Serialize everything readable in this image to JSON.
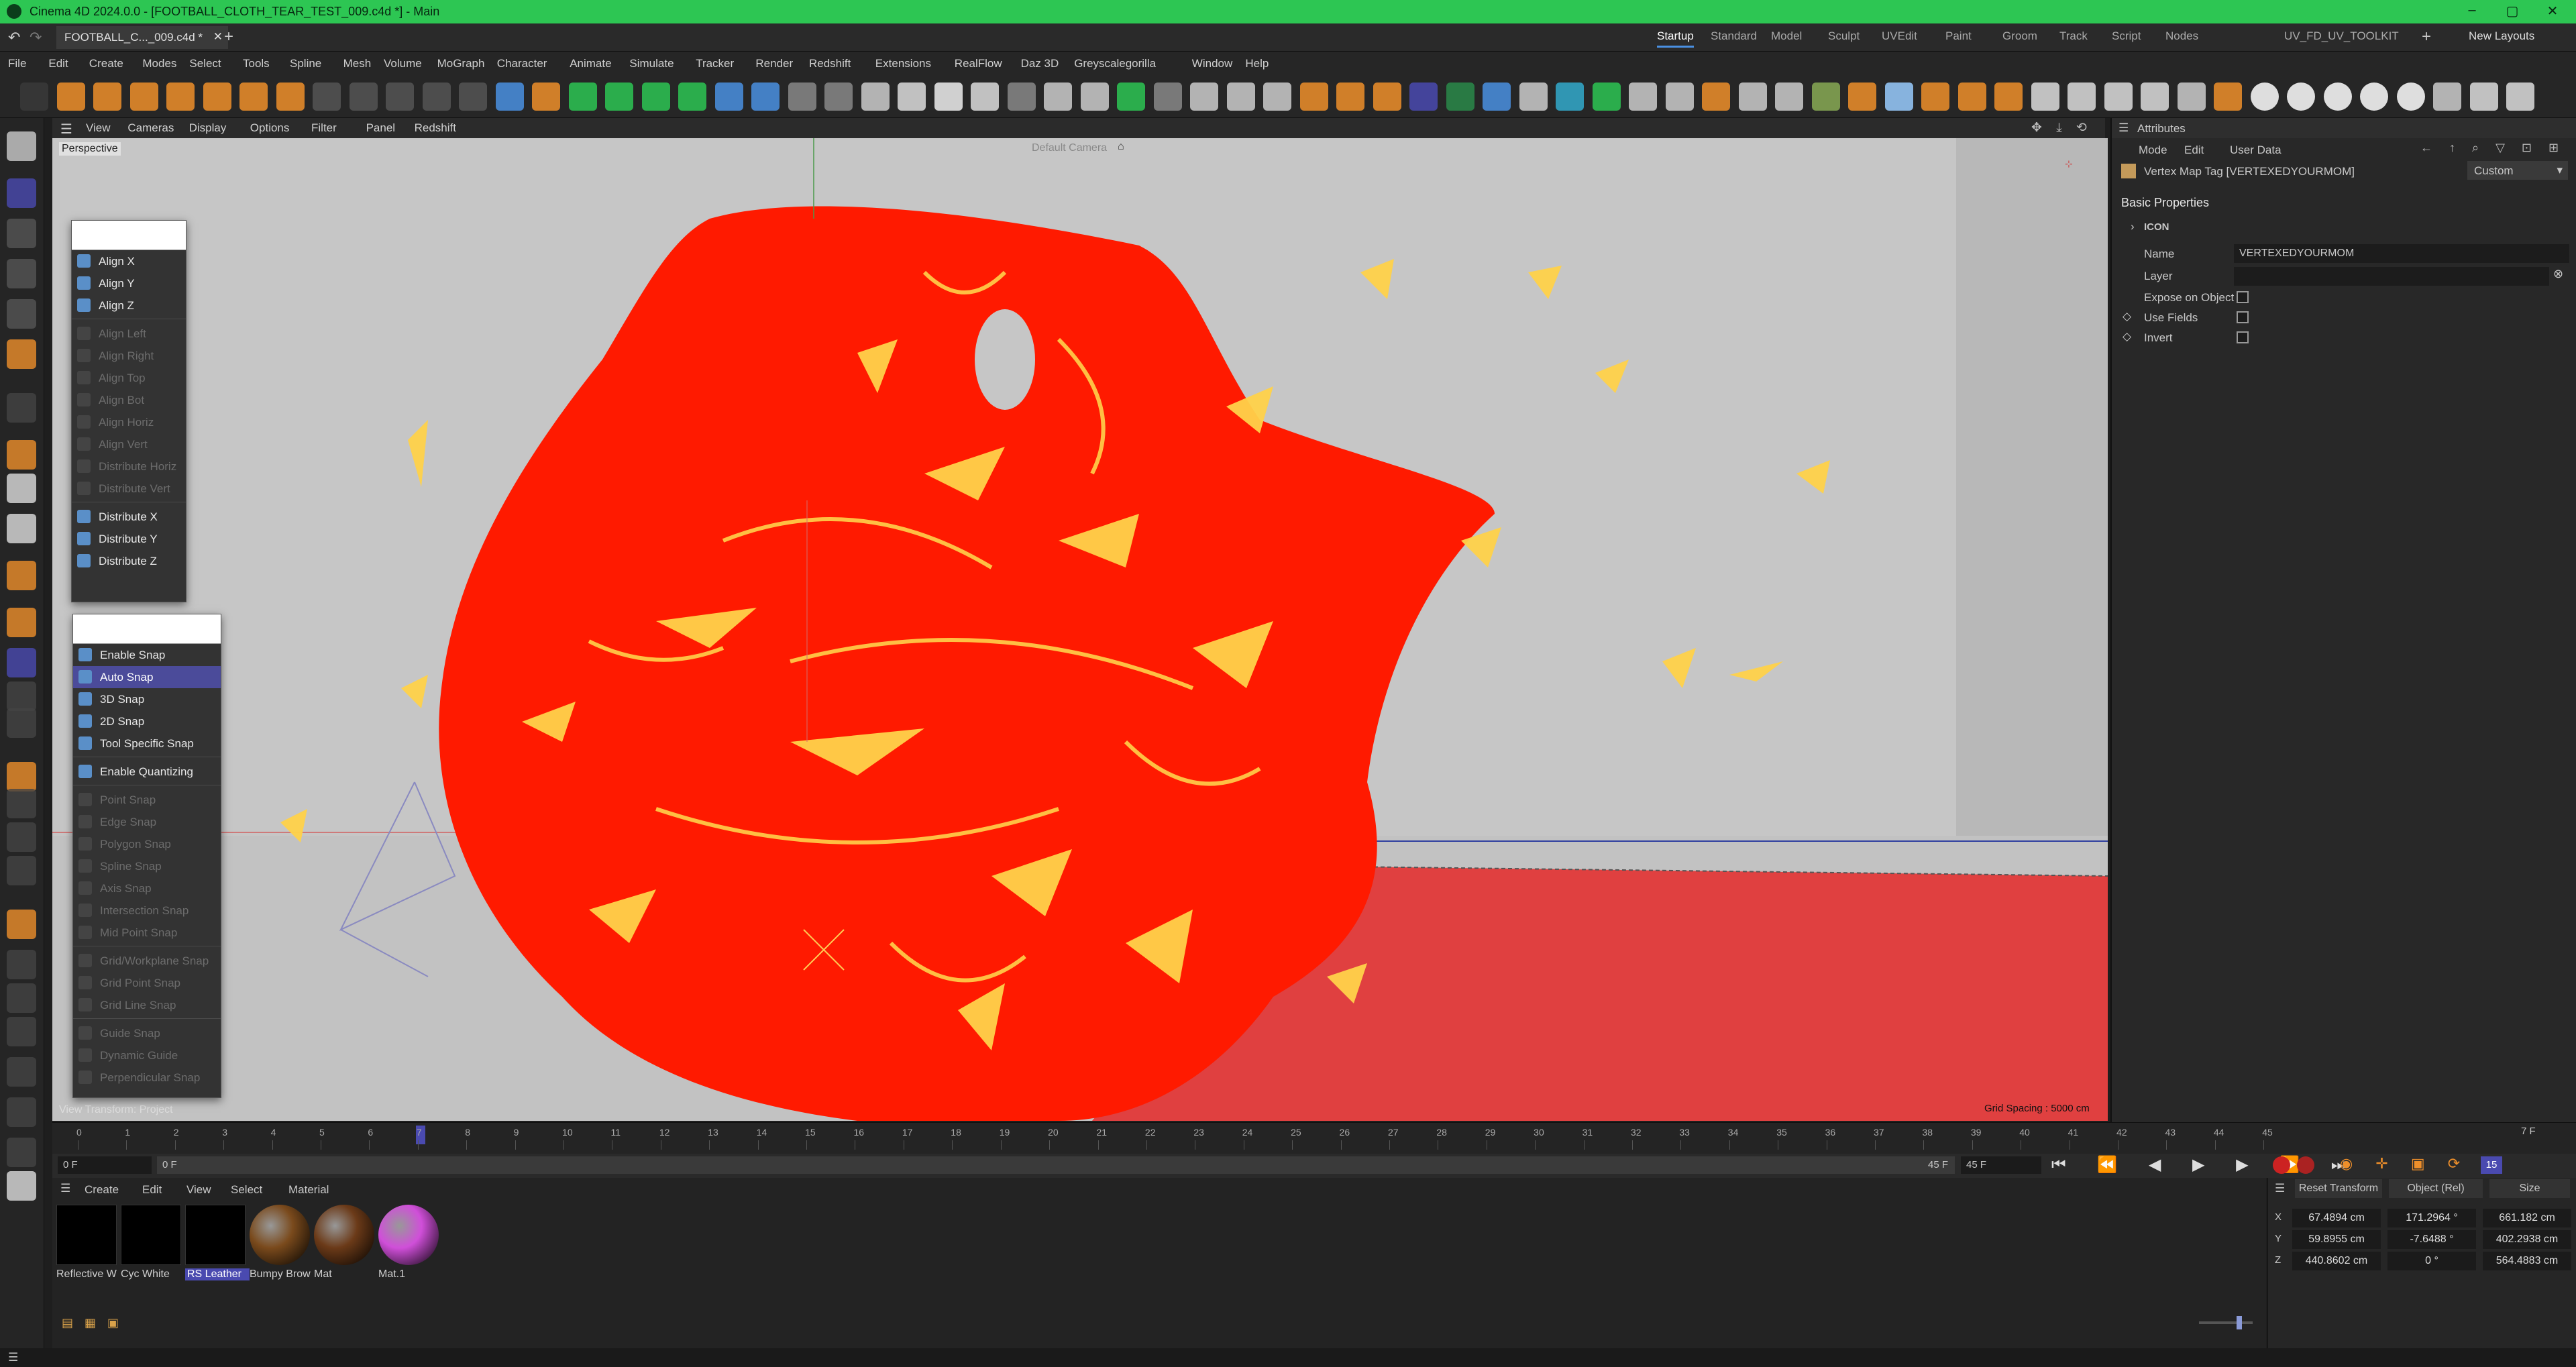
{
  "window": {
    "title": "Cinema 4D 2024.0.0 - [FOOTBALL_CLOTH_TEAR_TEST_009.c4d *] - Main",
    "doc_tab": "FOOTBALL_C..._009.c4d *",
    "accent_color": "#2dc653"
  },
  "layouts": [
    "Startup",
    "Standard",
    "Model",
    "Sculpt",
    "UVEdit",
    "Paint",
    "Groom",
    "Track",
    "Script",
    "Nodes",
    "UV_FD_UV_TOOLKIT"
  ],
  "new_layouts_label": "New Layouts",
  "menubar": [
    "File",
    "Edit",
    "Create",
    "Modes",
    "Select",
    "Tools",
    "Spline",
    "Mesh",
    "Volume",
    "MoGraph",
    "Character",
    "Animate",
    "Simulate",
    "Tracker",
    "Render",
    "Redshift",
    "Extensions",
    "RealFlow",
    "Daz 3D",
    "Greyscalegorilla",
    "Window",
    "Help"
  ],
  "viewport_menu": [
    "View",
    "Cameras",
    "Display",
    "Options",
    "Filter",
    "Panel",
    "Redshift"
  ],
  "viewport": {
    "label": "Perspective",
    "camera_label": "Default Camera",
    "grid_spacing": "Grid Spacing : 5000 cm",
    "view_transform": "View Transform: Project"
  },
  "align_menu": {
    "items": [
      {
        "label": "Align X",
        "enabled": true
      },
      {
        "label": "Align Y",
        "enabled": true
      },
      {
        "label": "Align Z",
        "enabled": true
      },
      {
        "label": "Align Left",
        "enabled": false
      },
      {
        "label": "Align Right",
        "enabled": false
      },
      {
        "label": "Align Top",
        "enabled": false
      },
      {
        "label": "Align Bot",
        "enabled": false
      },
      {
        "label": "Align Horiz",
        "enabled": false
      },
      {
        "label": "Align Vert",
        "enabled": false
      },
      {
        "label": "Distribute Horiz",
        "enabled": false
      },
      {
        "label": "Distribute Vert",
        "enabled": false
      },
      {
        "label": "Distribute X",
        "enabled": true
      },
      {
        "label": "Distribute Y",
        "enabled": true
      },
      {
        "label": "Distribute Z",
        "enabled": true
      }
    ]
  },
  "snap_menu": {
    "items": [
      {
        "label": "Enable Snap",
        "enabled": true
      },
      {
        "label": "Auto Snap",
        "enabled": true,
        "highlighted": true
      },
      {
        "label": "3D Snap",
        "enabled": true
      },
      {
        "label": "2D Snap",
        "enabled": true
      },
      {
        "label": "Tool Specific Snap",
        "enabled": true
      },
      {
        "label": "Enable Quantizing",
        "enabled": true
      },
      {
        "label": "Point Snap",
        "enabled": false
      },
      {
        "label": "Edge Snap",
        "enabled": false
      },
      {
        "label": "Polygon Snap",
        "enabled": false
      },
      {
        "label": "Spline Snap",
        "enabled": false
      },
      {
        "label": "Axis Snap",
        "enabled": false
      },
      {
        "label": "Intersection Snap",
        "enabled": false
      },
      {
        "label": "Mid Point Snap",
        "enabled": false
      },
      {
        "label": "Grid/Workplane Snap",
        "enabled": false
      },
      {
        "label": "Grid Point Snap",
        "enabled": false
      },
      {
        "label": "Grid Line Snap",
        "enabled": false
      },
      {
        "label": "Guide Snap",
        "enabled": false
      },
      {
        "label": "Dynamic Guide",
        "enabled": false
      },
      {
        "label": "Perpendicular Snap",
        "enabled": false
      }
    ]
  },
  "attributes": {
    "panel_title": "Attributes",
    "menu": [
      "Mode",
      "Edit",
      "User Data"
    ],
    "object_title": "Vertex Map Tag [VERTEXEDYOURMOM]",
    "preset": "Custom",
    "section": "Basic Properties",
    "group": "ICON",
    "fields": {
      "name_label": "Name",
      "name_value": "VERTEXEDYOURMOM",
      "layer_label": "Layer",
      "expose_label": "Expose on Object",
      "use_fields_label": "Use Fields",
      "invert_label": "Invert"
    }
  },
  "timeline": {
    "ticks": [
      "0",
      "1",
      "2",
      "3",
      "4",
      "5",
      "6",
      "7",
      "8",
      "9",
      "10",
      "11",
      "12",
      "13",
      "14",
      "15",
      "16",
      "17",
      "18",
      "19",
      "20",
      "21",
      "22",
      "23",
      "24",
      "25",
      "26",
      "27",
      "28",
      "29",
      "30",
      "31",
      "32",
      "33",
      "34",
      "35",
      "36",
      "37",
      "38",
      "39",
      "40",
      "41",
      "42",
      "43",
      "44",
      "45"
    ],
    "current_frame": "7 F",
    "start_frame": "0 F",
    "range_start": "0 F",
    "range_end": "45 F",
    "end_frame": "45 F",
    "fps_badge": "15"
  },
  "materials": {
    "menu": [
      "Create",
      "Edit",
      "View",
      "Select",
      "Material"
    ],
    "items": [
      {
        "label": "Reflective W",
        "color": "#000000"
      },
      {
        "label": "Cyc White",
        "color": "#000000"
      },
      {
        "label": "RS Leather",
        "color": "#000000",
        "selected": true
      },
      {
        "label": "Bumpy Brow",
        "color": "#7a4a1c"
      },
      {
        "label": "Mat",
        "color": "#6b3a18"
      },
      {
        "label": "Mat.1",
        "color": "#d04fd9"
      }
    ]
  },
  "coordinates": {
    "reset_label": "Reset Transform",
    "mode_label": "Object (Rel)",
    "size_label": "Size",
    "rows": [
      {
        "axis": "X",
        "pos": "67.4894 cm",
        "rot": "171.2964 °",
        "size": "661.182 cm"
      },
      {
        "axis": "Y",
        "pos": "59.8955 cm",
        "rot": "-7.6488 °",
        "size": "402.2938 cm"
      },
      {
        "axis": "Z",
        "pos": "440.8602 cm",
        "rot": "0 °",
        "size": "564.4883 cm"
      }
    ]
  }
}
